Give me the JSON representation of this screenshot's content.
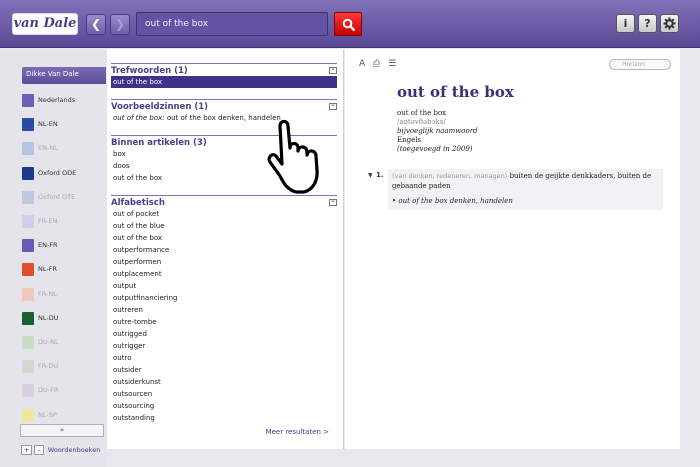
{
  "topbar": {
    "logo": "van Dale",
    "back_label": "❮",
    "forward_label": "❯",
    "search_value": "out of the box",
    "search_button_icon": "magnifier-icon",
    "info_label": "i",
    "help_label": "?",
    "settings_icon": "gear-icon",
    "accent": "#5a4896"
  },
  "sidebar": {
    "user": "Dikke Van Dale",
    "items": [
      {
        "label": "Nederlands",
        "color": "#6b5fb8",
        "dim": false
      },
      {
        "label": "NL-EN",
        "color": "#2a4aa8",
        "dim": false
      },
      {
        "label": "EN-NL",
        "color": "#b8c4e4",
        "dim": true
      },
      {
        "label": "Oxford ODE",
        "color": "#1c3a8a",
        "dim": false
      },
      {
        "label": "Oxford OTE",
        "color": "#c0c8e0",
        "dim": true
      },
      {
        "label": "FR-EN",
        "color": "#d4cce8",
        "dim": true
      },
      {
        "label": "EN-FR",
        "color": "#6a58b8",
        "dim": false
      },
      {
        "label": "NL-FR",
        "color": "#e05030",
        "dim": false
      },
      {
        "label": "FR-NL",
        "color": "#f0c8c0",
        "dim": true
      },
      {
        "label": "NL-DU",
        "color": "#1a6030",
        "dim": false
      },
      {
        "label": "DU-NL",
        "color": "#c8dcc8",
        "dim": true
      },
      {
        "label": "FR-DU",
        "color": "#d0d8d0",
        "dim": true
      },
      {
        "label": "DU-FR",
        "color": "#d8d0e0",
        "dim": true
      },
      {
        "label": "NL-SP",
        "color": "#f0e8a0",
        "dim": true
      }
    ],
    "expand_label": "»",
    "footer_label": "Woordenboeken",
    "footer_plus": "+",
    "footer_minus": "–"
  },
  "results": {
    "trefwoorden": {
      "title": "Trefwoorden (1)",
      "items": [
        "out of the box"
      ]
    },
    "voorbeeldzinnen": {
      "title": "Voorbeeldzinnen (1)",
      "example_italic": "out of the box:",
      "example_rest": " out of the box denken, handelen"
    },
    "binnen": {
      "title": "Binnen artikelen (3)",
      "items": [
        "box",
        "doos",
        "out of the box"
      ]
    },
    "alfabetisch": {
      "title": "Alfabetisch",
      "items": [
        "out of pocket",
        "out of the blue",
        "out of the box",
        "outperformance",
        "outperformen",
        "outplacement",
        "output",
        "outputfinanciering",
        "outreren",
        "outre-tombe",
        "outrigged",
        "outrigger",
        "outro",
        "outsider",
        "outsiderkunst",
        "outsourcen",
        "outsourcing",
        "outstanding"
      ]
    },
    "collapse_label": "–",
    "more": "Meer resultaten >"
  },
  "entry": {
    "tool_icons": [
      "font-size-icon",
      "print-icon",
      "list-icon"
    ],
    "tool_glyphs": [
      "A",
      "⎙",
      "☰"
    ],
    "search_placeholder": "Horizon",
    "headword": "out of the box",
    "lines": [
      "out of the box",
      "/aʊtəvðəbɔks/",
      "bijvoeglijk naamwoord",
      "Engels",
      "(toegevoegd in 2009)"
    ],
    "sense": {
      "number": "1.",
      "gray": "(van denken, redeneren, managen)",
      "definition": " buiten de geijkte denkkaders, buiten de gebaande paden",
      "example": "out of the box denken, handelen"
    }
  }
}
